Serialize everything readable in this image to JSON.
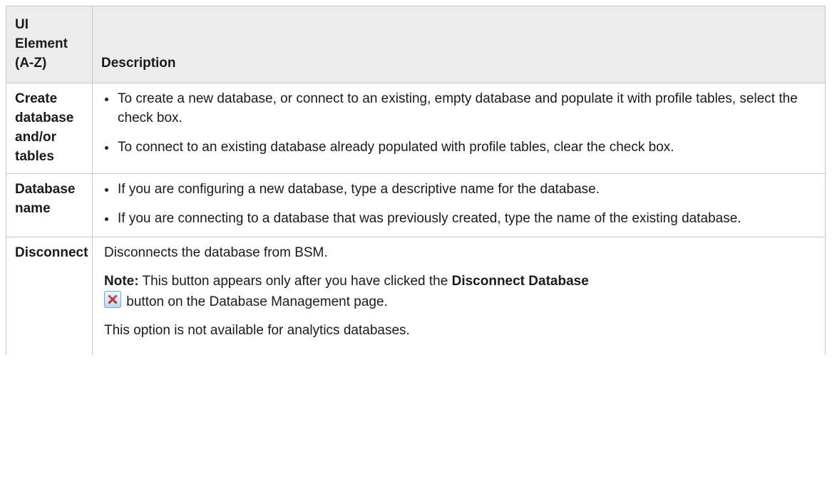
{
  "table": {
    "headers": {
      "element": "UI Element (A-Z)",
      "description": "Description"
    },
    "rows": [
      {
        "element": "Create database and/or tables",
        "bullets": [
          "To create a new database, or connect to an existing, empty database and populate it with profile tables, select the check box.",
          "To connect to an existing database already populated with profile tables, clear the check box."
        ]
      },
      {
        "element": "Database name",
        "bullets": [
          "If you are configuring a new database, type a descriptive name for the database.",
          "If you are connecting to a database that was previously created, type the name of the existing database."
        ]
      },
      {
        "element": "Disconnect",
        "text": "Disconnects the database from BSM.",
        "note_label": "Note:",
        "note_text_1": " This button appears only after you have clicked the ",
        "note_bold": "Disconnect Database",
        "note_icon": "disconnect-x-icon",
        "note_text_2": " button on the Database Management page.",
        "extra": "This option is not available for analytics databases."
      }
    ]
  },
  "colors": {
    "header_bg": "#ececec",
    "border": "#c6c6c6",
    "icon_red": "#d62b2b"
  }
}
